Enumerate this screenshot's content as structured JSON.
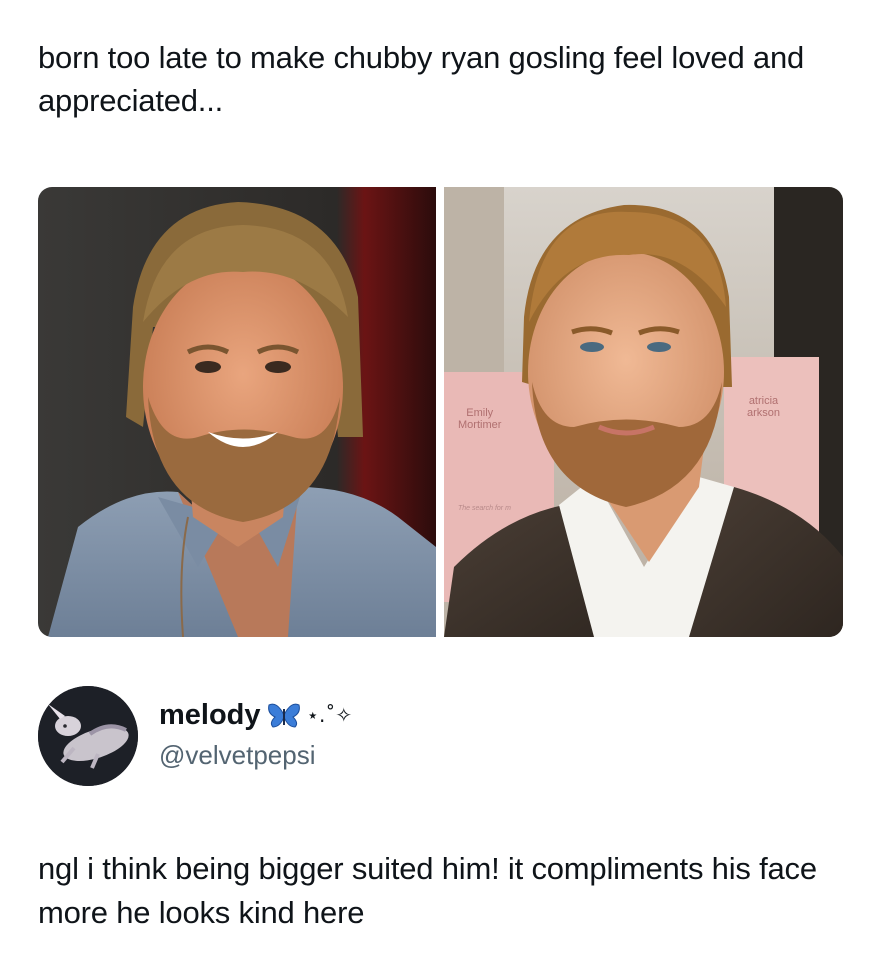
{
  "post": {
    "text": "born too late to make chubby ryan gosling feel loved and appreciated..."
  },
  "photos": {
    "left": {
      "icon": "portrait-photo-smiling-man"
    },
    "right": {
      "icon": "portrait-photo-man-in-suit",
      "poster_left": "Emily\nMortimer",
      "poster_right": "atricia\narkson",
      "poster_small": "The search for m"
    }
  },
  "reply": {
    "display_name": "melody",
    "handle": "@velvetpepsi",
    "name_emoji": "butterfly-icon",
    "sparkle_text": "⋆.˚✧",
    "text": "ngl i think being bigger suited him! it compliments his face more he looks kind here"
  },
  "colors": {
    "text": "#0f1419",
    "handle": "#536471",
    "butterfly": "#3b7dd8"
  }
}
